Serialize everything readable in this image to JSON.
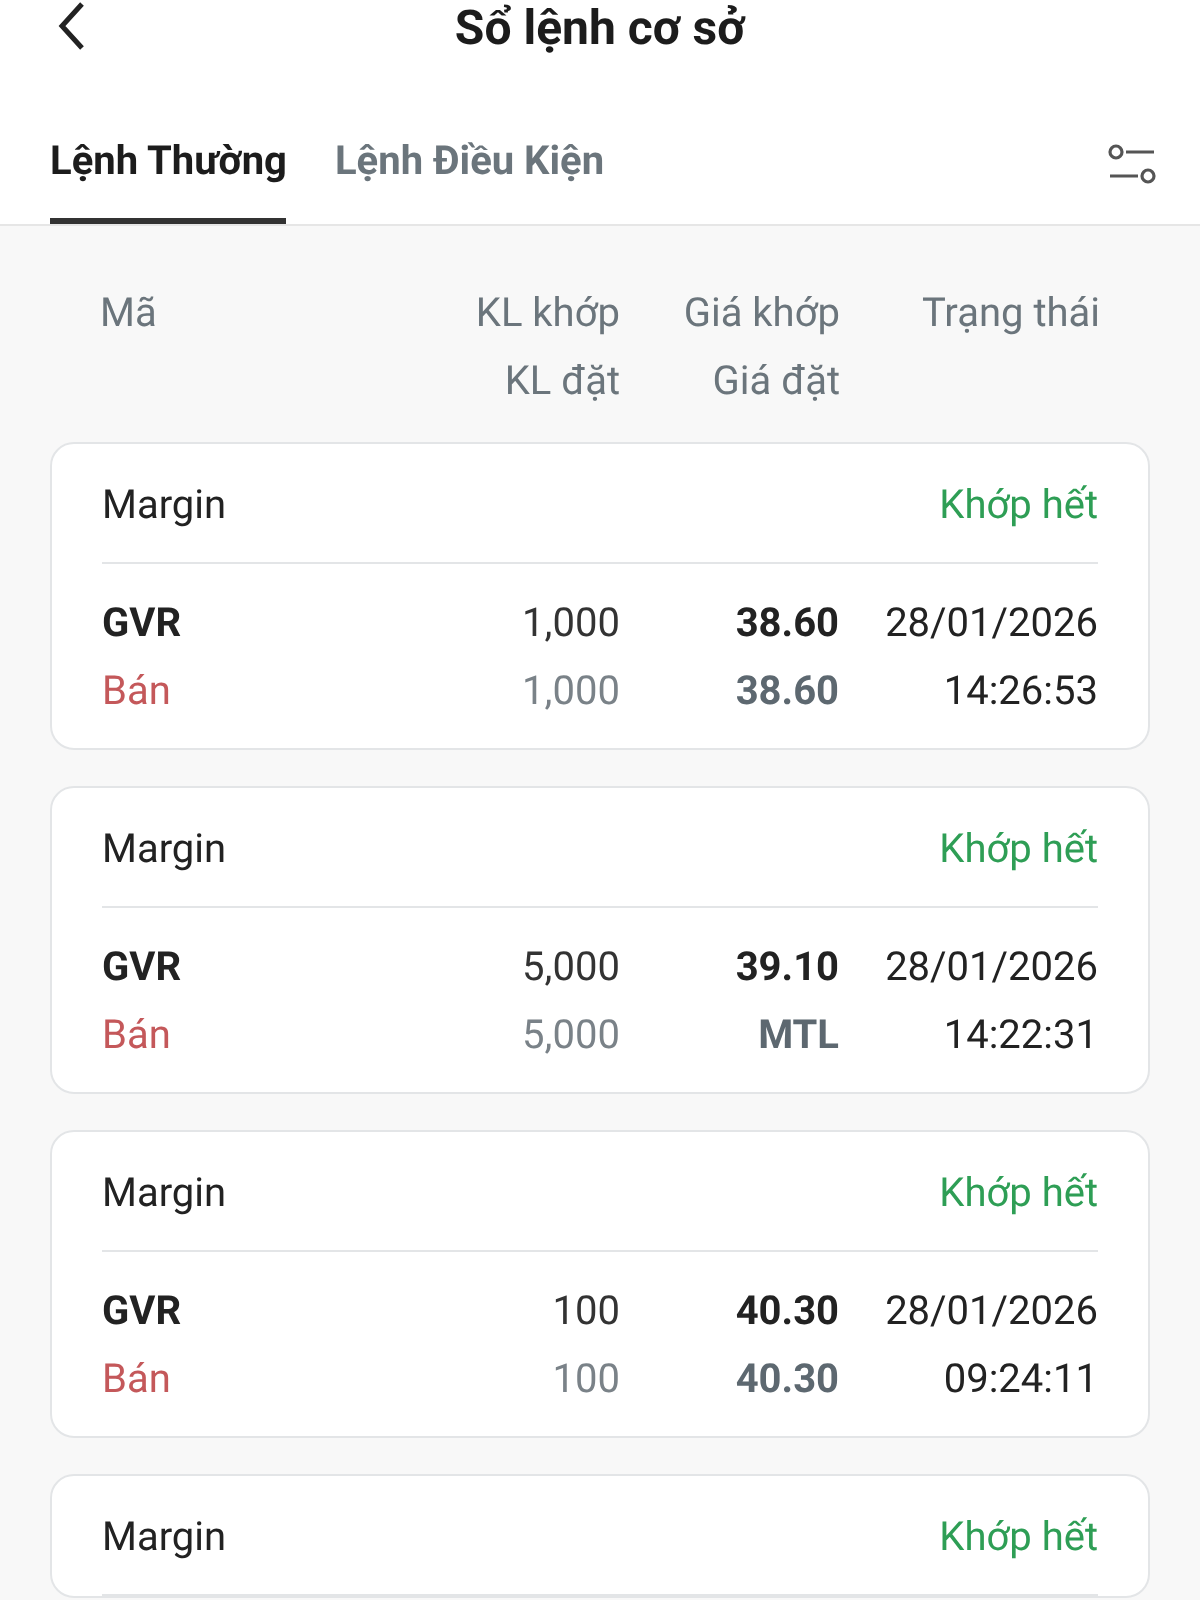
{
  "header": {
    "title": "Sổ lệnh cơ sở"
  },
  "tabs": [
    {
      "label": "Lệnh Thường",
      "selected": true
    },
    {
      "label": "Lệnh Điều Kiện",
      "selected": false
    }
  ],
  "columns": {
    "code": "Mã",
    "matched_qty": "KL khớp",
    "order_qty": "KL đặt",
    "matched_price": "Giá khớp",
    "order_price": "Giá đặt",
    "status": "Trạng thái"
  },
  "orders": [
    {
      "account": "Margin",
      "status": "Khớp hết",
      "code": "GVR",
      "side": "Bán",
      "matched_qty": "1,000",
      "order_qty": "1,000",
      "matched_price": "38.60",
      "order_price": "38.60",
      "date": "28/01/2026",
      "time": "14:26:53"
    },
    {
      "account": "Margin",
      "status": "Khớp hết",
      "code": "GVR",
      "side": "Bán",
      "matched_qty": "5,000",
      "order_qty": "5,000",
      "matched_price": "39.10",
      "order_price": "MTL",
      "date": "28/01/2026",
      "time": "14:22:31"
    },
    {
      "account": "Margin",
      "status": "Khớp hết",
      "code": "GVR",
      "side": "Bán",
      "matched_qty": "100",
      "order_qty": "100",
      "matched_price": "40.30",
      "order_price": "40.30",
      "date": "28/01/2026",
      "time": "09:24:11"
    },
    {
      "account": "Margin",
      "status": "Khớp hết"
    }
  ]
}
